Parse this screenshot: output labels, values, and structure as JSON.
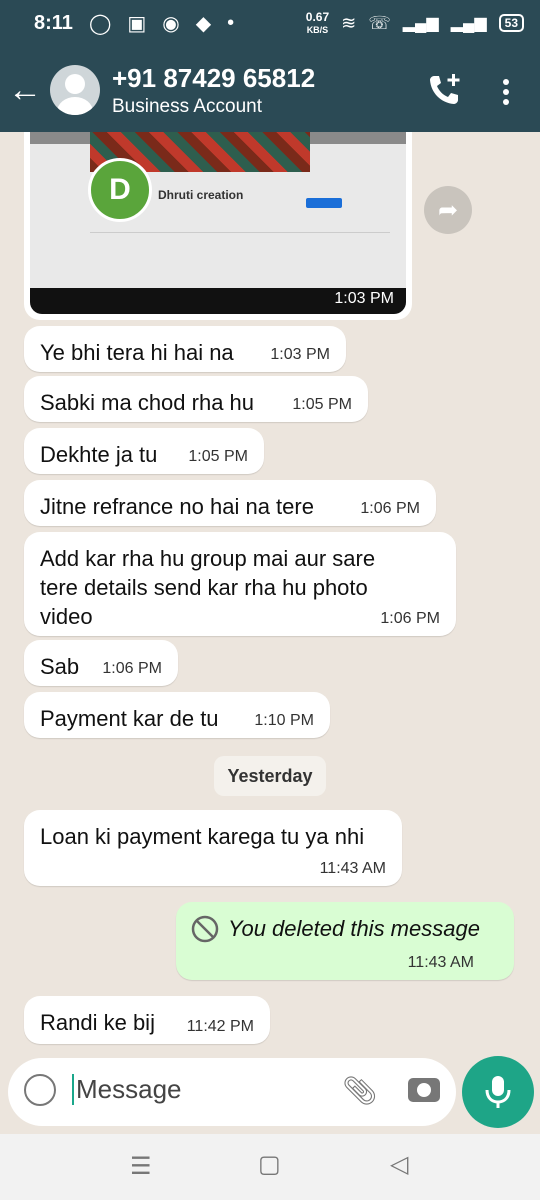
{
  "status_bar": {
    "time": "8:11",
    "net_speed": "0.67",
    "net_unit": "KB/S",
    "battery": "53"
  },
  "header": {
    "contact": "+91 87429 65812",
    "subtitle": "Business Account"
  },
  "image_message": {
    "profile_initial": "D",
    "profile_name": "Dhruti creation",
    "time": "1:03 PM"
  },
  "messages": [
    {
      "text": "Ye bhi tera hi hai na",
      "time": "1:03 PM"
    },
    {
      "text": "Sabki ma chod rha hu",
      "time": "1:05 PM"
    },
    {
      "text": "Dekhte ja tu",
      "time": "1:05 PM"
    },
    {
      "text": "Jitne refrance no hai na tere",
      "time": "1:06 PM"
    },
    {
      "text_lines": [
        "Add kar rha hu group mai aur sare",
        "tere details send kar rha hu photo",
        "video"
      ],
      "time": "1:06 PM"
    },
    {
      "text": "Sab",
      "time": "1:06 PM"
    },
    {
      "text": "Payment kar de tu",
      "time": "1:10 PM"
    },
    {
      "text": "Loan ki payment karega tu ya nhi",
      "time": "11:43 AM"
    },
    {
      "text": "You deleted this message",
      "time": "11:43 AM"
    },
    {
      "text": "Randi ke bij",
      "time": "11:42 PM"
    }
  ],
  "date_divider": "Yesterday",
  "composer": {
    "placeholder": "Message"
  }
}
